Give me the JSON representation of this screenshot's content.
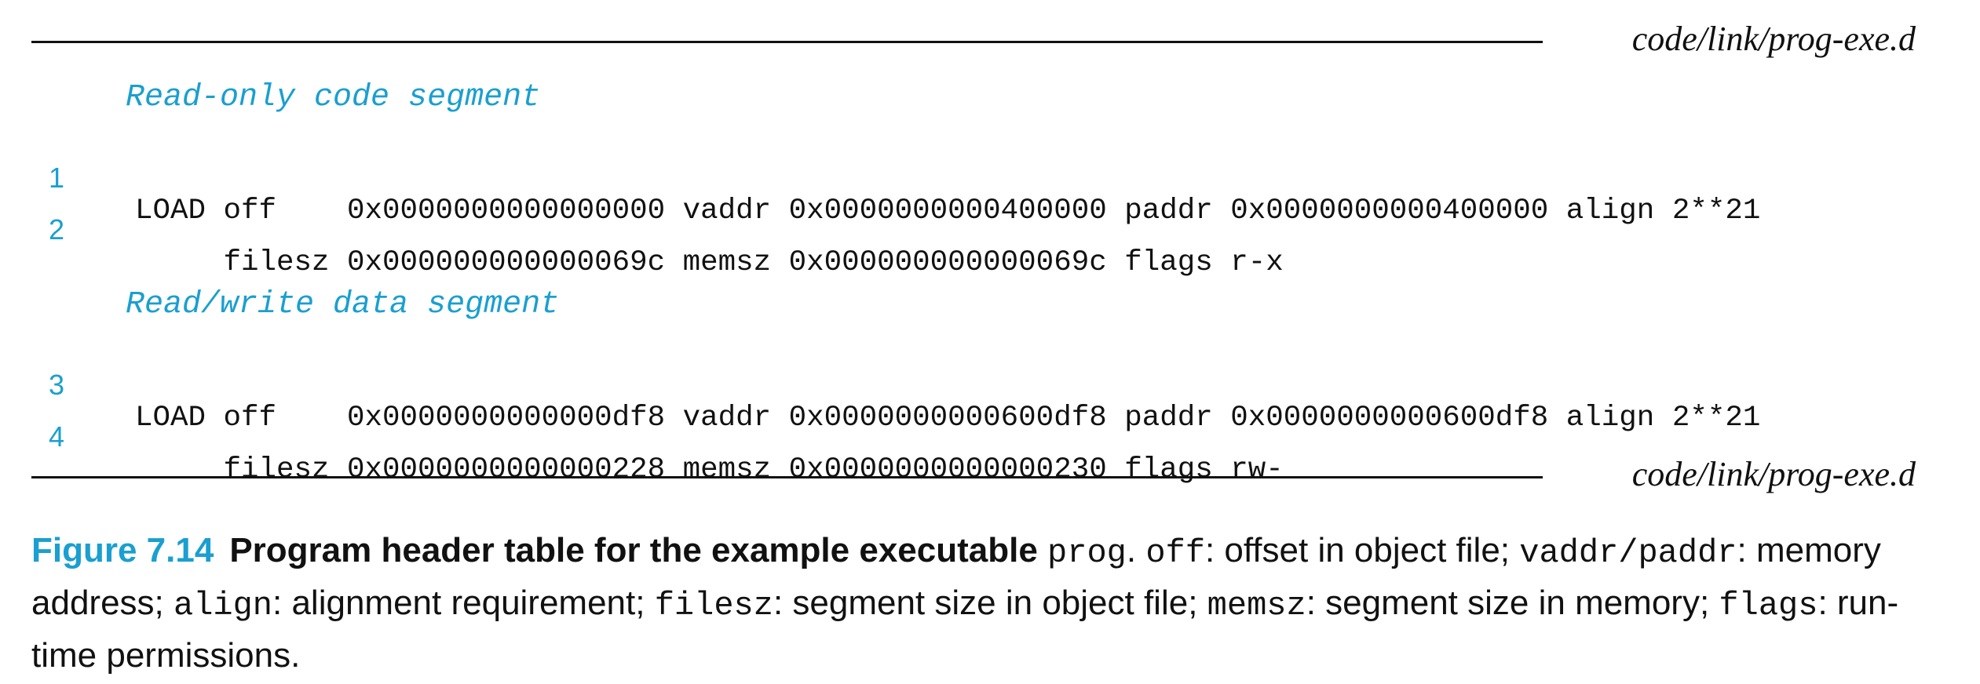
{
  "listing": {
    "file_label": "code/link/prog-exe.d",
    "sections": [
      {
        "heading": "Read-only code segment",
        "lines": [
          {
            "number": "1",
            "code": "LOAD off    0x0000000000000000 vaddr 0x0000000000400000 paddr 0x0000000000400000 align 2**21"
          },
          {
            "number": "2",
            "code": "     filesz 0x000000000000069c memsz 0x000000000000069c flags r-x"
          }
        ]
      },
      {
        "heading": "Read/write data segment",
        "lines": [
          {
            "number": "3",
            "code": "LOAD off    0x0000000000000df8 vaddr 0x0000000000600df8 paddr 0x0000000000600df8 align 2**21"
          },
          {
            "number": "4",
            "code": "     filesz 0x0000000000000228 memsz 0x0000000000000230 flags rw-"
          }
        ]
      }
    ]
  },
  "caption": {
    "label": "Figure 7.14",
    "title": "Program header table for the example executable",
    "parts": [
      {
        "text": " ",
        "style": "plain"
      },
      {
        "text": "prog",
        "style": "mono"
      },
      {
        "text": ". ",
        "style": "plain"
      },
      {
        "text": "off",
        "style": "mono"
      },
      {
        "text": ": offset in object file; ",
        "style": "plain"
      },
      {
        "text": "vaddr/paddr",
        "style": "mono"
      },
      {
        "text": ": memory address; ",
        "style": "plain"
      },
      {
        "text": "align",
        "style": "mono"
      },
      {
        "text": ": alignment requirement; ",
        "style": "plain"
      },
      {
        "text": "filesz",
        "style": "mono"
      },
      {
        "text": ": segment size in object file; ",
        "style": "plain"
      },
      {
        "text": "memsz",
        "style": "mono"
      },
      {
        "text": ": segment size in memory; ",
        "style": "plain"
      },
      {
        "text": "flags",
        "style": "mono"
      },
      {
        "text": ": run-time permissions.",
        "style": "plain"
      }
    ]
  },
  "colors": {
    "accent": "#1a9fd0",
    "text": "#111111"
  }
}
